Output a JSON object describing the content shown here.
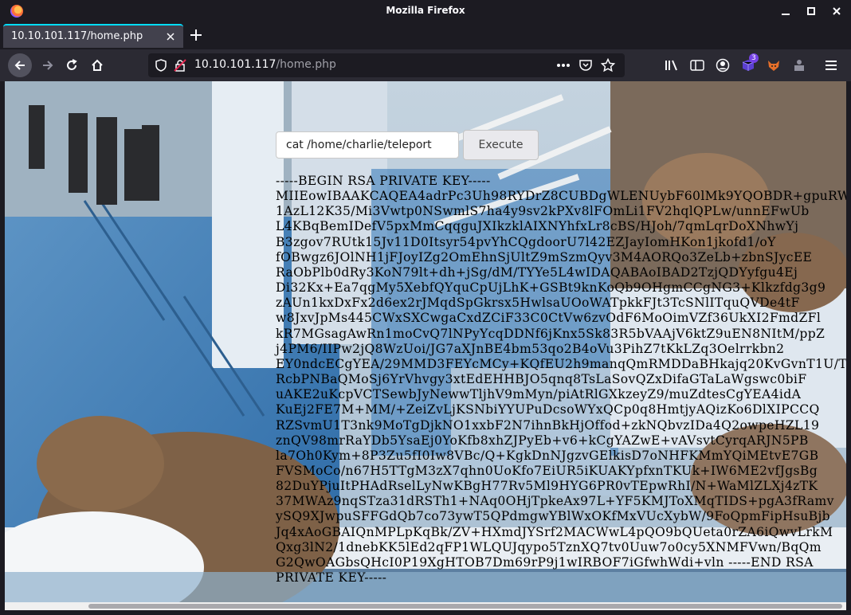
{
  "window": {
    "title": "Mozilla Firefox"
  },
  "tab": {
    "title": "10.10.101.117/home.php"
  },
  "urlbar": {
    "host": "10.10.101.117",
    "path": "/home.php"
  },
  "extensions": {
    "badge": "3"
  },
  "page": {
    "command_value": "cat /home/charlie/teleport",
    "execute_label": "Execute",
    "output_lines": [
      "-----BEGIN RSA PRIVATE KEY-----",
      "MIIEowIBAAKCAQEA4adrPc3Uh98RYDrZ8CUBDgWLENUybF60lMk9YQOBDR+gpuRW",
      "1AzL12K35/Mi3Vwtp0NSwmlS7ha4y9sv2kPXv8lFOmLi1FV2hqlQPLw/unnEFwUb",
      "L4KBqBemIDefV5pxMmCqqguJXIkzklAIXNYhfxLr8cBS/HJoh/7qmLqrDoXNhwYj",
      "B3zgov7RUtk15Jv11D0Itsyr54pvYhCQgdoorU7l42EZJayIomHKon1jkofd1/oY",
      "fOBwgz6JOlNH1jFJoyIZg2OmEhnSjUltZ9mSzmQyv3M4AORQo3ZeLb+zbnSJycEE",
      "RaObPlb0dRy3KoN79lt+dh+jSg/dM/TYYe5L4wIDAQABAoIBAD2TzjQDYyfgu4Ej",
      "Di32Kx+Ea7qgMy5XebfQYquCpUjLhK+GSBt9knKoQb9OHgmCCgNG3+Klkzfdg3g9",
      "zAUn1kxDxFx2d6ex2rJMqdSpGkrsx5HwlsaUOoWATpkkFJt3TcSNlITquQVDe4tF",
      "w8JxvJpMs445CWxSXCwgaCxdZCiF33C0CtVw6zvOdF6MoOimVZf36UkXI2FmdZFl",
      "kR7MGsagAwRn1moCvQ7lNPyYcqDDNf6jKnx5Sk83R5bVAAjV6ktZ9uEN8NItM/ppZ",
      "j4PM6/IIPw2jQ8WzUoi/JG7aXJnBE4bm53qo2B4oVu3PihZ7tKkLZq3Oelrrkbn2",
      "EY0ndcECgYEA/29MMD3FEYcMCy+KQfEU2h9manqQmRMDDaBHkajq20KvGvnT1U/T",
      "RcbPNBaQMoSj6YrVhvgy3xtEdEHHBJO5qnq8TsLaSovQZxDifaGTaLaWgswc0biF",
      "uAKE2uKcpVCTSewbJyNewwTljhV9mMyn/piAtRlGXkzeyZ9/muZdtesCgYEA4idA",
      "KuEj2FE7M+MM/+ZeiZvLjKSNbiYYUPuDcsoWYxQCp0q8HmtjyAQizKo6DlXIPCCQ",
      "RZSvmU1T3nk9MoTgDjkNO1xxbF2N7ihnBkHjOffod+zkNQbvzIDa4Q2owpeHZL19",
      "znQV98mrRaYDb5YsaEj0YoKfb8xhZJPyEb+v6+kCgYAZwE+vAVsvtCyrqARJN5PB",
      "la7Oh0Kym+8P3Zu5fI0Iw8VBc/Q+KgkDnNJgzvGElkisD7oNHFKMmYQiMEtvE7GB",
      "FVSMoCo/n67H5TTgM3zX7qhn0UoKfo7EiUR5iKUAKYpfxnTKUk+IW6ME2vfJgsBg",
      "82DuYPjuItPHAdRselLyNwKBgH77Rv5Ml9HYG6PR0vTEpwRhI/N+WaMlZLXj4zTK",
      "37MWAz9nqSTza31dRSTh1+NAq0OHjTpkeAx97L+YF5KMJToXMqTIDS+pgA3fRamv",
      "ySQ9XJwpuSFFGdQb7co73ywT5QPdmgwYBlWxOKfMxVUcXybW/9FoQpmFipHsuBjb",
      "Jq4xAoGBAIQnMPLpKqBk/ZV+HXmdJYSrf2MACWwL4pQO9bQUeta0rZA6iQwvLrkM",
      "Qxg3lN2/1dnebKK5lEd2qFP1WLQUJqypo5TznXQ7tv0Uuw7o0cy5XNMFVwn/BqQm",
      "G2QwOAGbsQHcI0P19XgHTOB7Dm69rP9j1wIRBOF7iGfwhWdi+vln -----END RSA",
      "PRIVATE KEY-----"
    ]
  }
}
